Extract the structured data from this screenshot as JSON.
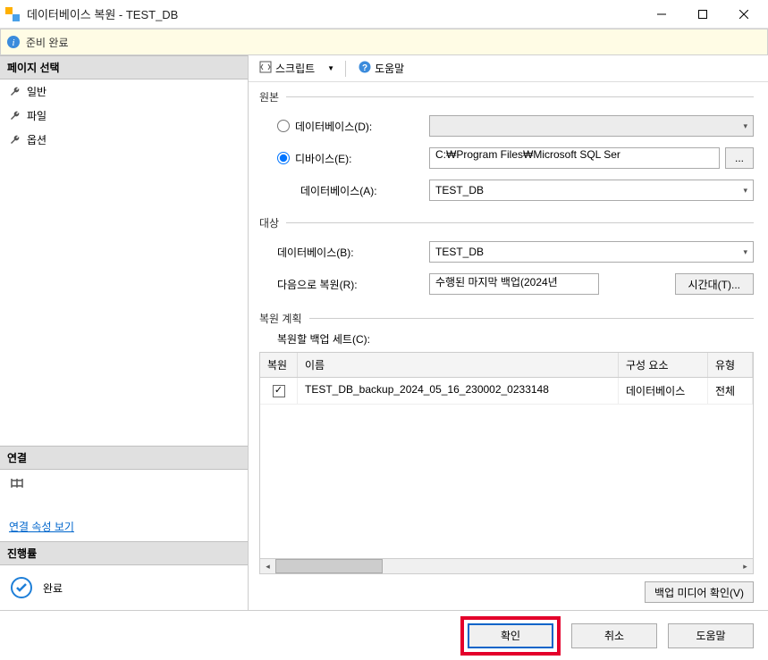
{
  "window": {
    "title": "데이터베이스 복원 - TEST_DB"
  },
  "infobar": {
    "text": "준비 완료"
  },
  "sidebar": {
    "pages_header": "페이지 선택",
    "items": [
      {
        "label": "일반"
      },
      {
        "label": "파일"
      },
      {
        "label": "옵션"
      }
    ],
    "connection_header": "연결",
    "connection_link": "연결 속성 보기",
    "progress_header": "진행률",
    "progress_status": "완료"
  },
  "toolbar": {
    "script": "스크립트",
    "help": "도움말"
  },
  "source": {
    "legend": "원본",
    "radio_database": "데이터베이스(D):",
    "radio_device": "디바이스(E):",
    "device_path": "C:₩Program Files₩Microsoft SQL Ser",
    "browse": "...",
    "database_label": "데이터베이스(A):",
    "database_value": "TEST_DB"
  },
  "target": {
    "legend": "대상",
    "database_label": "데이터베이스(B):",
    "database_value": "TEST_DB",
    "restore_to_label": "다음으로 복원(R):",
    "restore_to_value": "수행된 마지막 백업(2024년",
    "timeline_button": "시간대(T)..."
  },
  "plan": {
    "legend": "복원 계획",
    "sets_label": "복원할 백업 세트(C):",
    "columns": {
      "restore": "복원",
      "name": "이름",
      "component": "구성 요소",
      "type": "유형"
    },
    "rows": [
      {
        "checked": true,
        "name": "TEST_DB_backup_2024_05_16_230002_0233148",
        "component": "데이터베이스",
        "type": "전체"
      }
    ],
    "verify_button": "백업 미디어 확인(V)"
  },
  "footer": {
    "ok": "확인",
    "cancel": "취소",
    "help": "도움말"
  }
}
